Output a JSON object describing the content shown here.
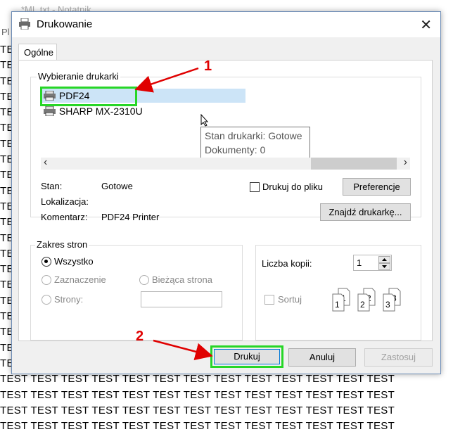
{
  "notepad": {
    "title": "*ML.txt - Notatnik",
    "menu_partial": "Pl",
    "test_word": "TEST"
  },
  "dialog": {
    "title": "Drukowanie",
    "close_glyph": "✕",
    "tab_general": "Ogólne",
    "select_printer": {
      "group_label": "Wybieranie drukarki",
      "printers": [
        "PDF24",
        "SHARP MX-2310U"
      ],
      "selected": "PDF24",
      "tooltip_status": "Stan drukarki: Gotowe",
      "tooltip_docs": "Dokumenty: 0",
      "scroll_left": "‹",
      "scroll_right": "›"
    },
    "info": {
      "status_label": "Stan:",
      "status_value": "Gotowe",
      "location_label": "Lokalizacja:",
      "location_value": "",
      "comment_label": "Komentarz:",
      "comment_value": "PDF24 Printer",
      "print_to_file": "Drukuj do pliku",
      "print_to_file_checked": false,
      "preferences_button": "Preferencje",
      "find_printer_button": "Znajdź drukarkę..."
    },
    "page_range": {
      "group_label": "Zakres stron",
      "all": "Wszystko",
      "selection": "Zaznaczenie",
      "current_page": "Bieżąca strona",
      "pages": "Strony:",
      "selected_option": "all",
      "pages_value": ""
    },
    "copies": {
      "count_label": "Liczba kopii:",
      "count_value": "1",
      "collate_label": "Sortuj",
      "collate_checked": false
    },
    "buttons": {
      "print": "Drukuj",
      "cancel": "Anuluj",
      "apply": "Zastosuj"
    }
  },
  "annotations": {
    "marker_1": "1",
    "marker_2": "2",
    "highlight_color": "#27d627",
    "arrow_color": "#e00000"
  }
}
